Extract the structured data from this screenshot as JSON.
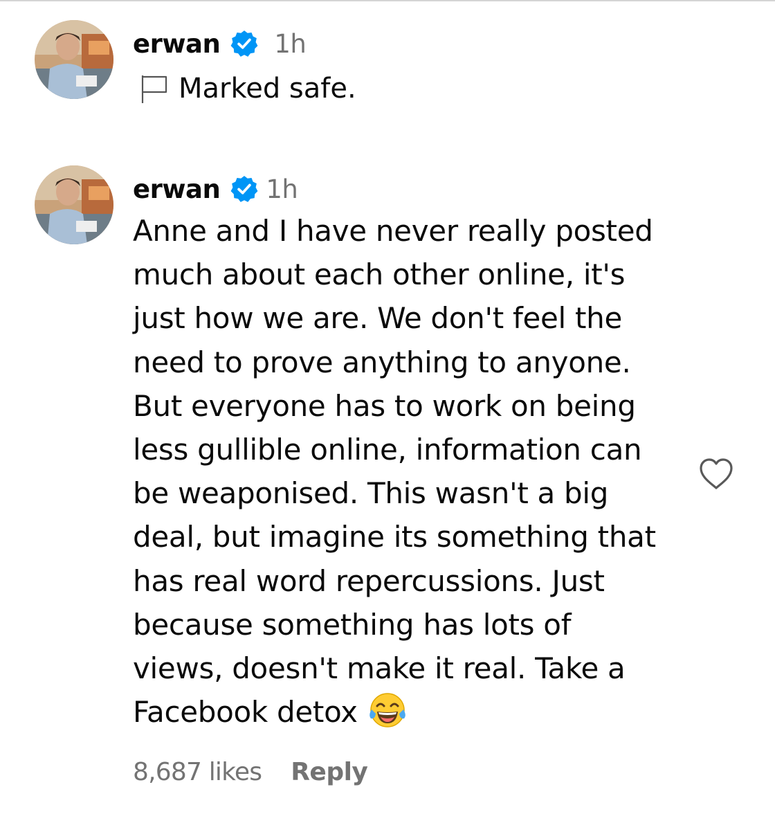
{
  "comments": [
    {
      "username": "erwan",
      "verified": true,
      "timestamp": "1h",
      "flag_icon": "flag-icon",
      "text": "Marked safe."
    },
    {
      "username": "erwan",
      "verified": true,
      "timestamp": "1h",
      "lines": [
        "Anne and I have never really posted",
        "much about each other online, it's",
        "just how we are. We don't feel the",
        "need to prove anything to anyone.",
        "But everyone has to work on being",
        "less gullible online, information can",
        "be weaponised. This wasn't a big",
        "deal, but imagine its something that",
        "has real word repercussions. Just",
        "because something has lots of",
        "views, doesn't make it real. Take a",
        "Facebook detox"
      ],
      "emoji_icon": "face-with-tears-of-joy-icon",
      "likes": "8,687 likes",
      "reply_label": "Reply",
      "like_icon": "heart-outline-icon"
    }
  ],
  "colors": {
    "text": "#0a0a0a",
    "secondary": "#737373",
    "verified": "#0095f6",
    "divider": "#d4d4d4"
  }
}
